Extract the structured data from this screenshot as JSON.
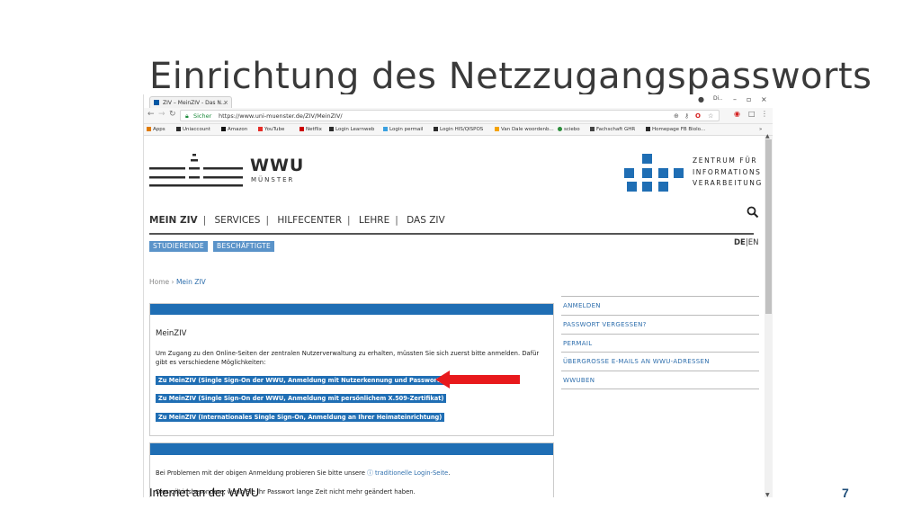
{
  "slide": {
    "title": "Einrichtung des Netzzugangspassworts",
    "footer": "Internet an der WWU",
    "page_number": "7"
  },
  "browser": {
    "tab_title": "ZIV – MeinZIV - Das N...",
    "window_user": "Di..",
    "secure_label": "Sicher",
    "url": "https://www.uni-muenster.de/ZIV/MeinZIV/",
    "bookmarks": [
      "Apps",
      "Uniaccount",
      "Amazon",
      "YouTube",
      "Netflix",
      "Login Learnweb",
      "Login permail",
      "Login HIS/QISPOS",
      "Van Dale woordenb...",
      "sciebo",
      "Fachschaft GHR",
      "Homepage FB Biolo..."
    ]
  },
  "site": {
    "wwu_name": "WWU",
    "wwu_city": "MÜNSTER",
    "ziv_lines": [
      "ZENTRUM FÜR",
      "INFORMATIONS",
      "VERARBEITUNG"
    ],
    "nav": [
      "MEIN ZIV",
      "SERVICES",
      "HILFECENTER",
      "LEHRE",
      "DAS ZIV"
    ],
    "audience": [
      "STUDIERENDE",
      "BESCHÄFTIGTE"
    ],
    "lang_active": "DE",
    "lang_sep": "|",
    "lang_other": "EN",
    "breadcrumb_home": "Home",
    "breadcrumb_sep": "›",
    "breadcrumb_current": "Mein ZIV"
  },
  "content": {
    "heading": "MeinZIV",
    "intro": "Um Zugang zu den Online-Seiten der zentralen Nutzerverwaltung zu erhalten, müssten Sie sich zuerst bitte anmelden. Dafür gibt es verschiedene Möglichkeiten:",
    "options": [
      "Zu MeinZIV (Single Sign-On der WWU, Anmeldung mit Nutzerkennung und Passwort)",
      "Zu MeinZIV (Single Sign-On der WWU, Anmeldung mit persönlichem X.509-Zertifikat)",
      "Zu MeinZIV (Internationales Single Sign-On, Anmeldung an Ihrer Heimateinrichtung)"
    ],
    "problem_text": "Bei Problemen mit der obigen Anmeldung probieren Sie bitte unsere",
    "problem_link": "traditionelle Login-Seite",
    "problem_end": ".",
    "partial_text": "Dies gilt insbesondere, wenn Sie Ihr Passwort lange Zeit nicht mehr geändert haben."
  },
  "sidebar": [
    "ANMELDEN",
    "PASSWORT VERGESSEN?",
    "PERMAIL",
    "ÜBERGROSSE E-MAILS AN WWU-ADRESSEN",
    "WWUBEN"
  ],
  "colors": {
    "brand_blue": "#1f6eb4",
    "arrow_red": "#e8191c",
    "link_blue": "#2f6fad"
  }
}
